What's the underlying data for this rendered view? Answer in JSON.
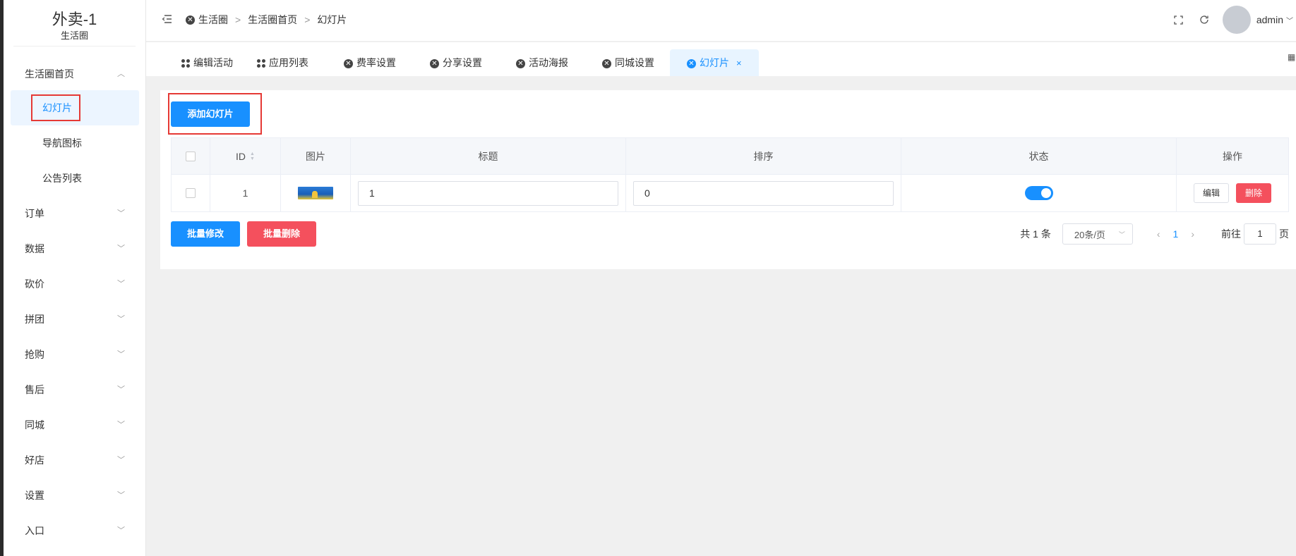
{
  "brand": {
    "title": "外卖-1",
    "subtitle": "生活圈"
  },
  "sidebar": {
    "items": [
      {
        "label": "生活圈首页",
        "chevron": "chevron-up-icon"
      },
      {
        "label": "幻灯片",
        "active": true
      },
      {
        "label": "导航图标"
      },
      {
        "label": "公告列表"
      },
      {
        "label": "订单",
        "chevron": "chevron-down-icon"
      },
      {
        "label": "数据",
        "chevron": "chevron-down-icon"
      },
      {
        "label": "砍价",
        "chevron": "chevron-down-icon"
      },
      {
        "label": "拼团",
        "chevron": "chevron-down-icon"
      },
      {
        "label": "抢购",
        "chevron": "chevron-down-icon"
      },
      {
        "label": "售后",
        "chevron": "chevron-down-icon"
      },
      {
        "label": "同城",
        "chevron": "chevron-down-icon"
      },
      {
        "label": "好店",
        "chevron": "chevron-down-icon"
      },
      {
        "label": "设置",
        "chevron": "chevron-down-icon"
      },
      {
        "label": "入口",
        "chevron": "chevron-down-icon"
      }
    ]
  },
  "breadcrumb": {
    "items": [
      "生活圈",
      "生活圈首页",
      "幻灯片"
    ],
    "separator": ">"
  },
  "user": {
    "name": "admin"
  },
  "tabs": [
    {
      "label": "编辑活动",
      "icon": "apps-icon"
    },
    {
      "label": "应用列表",
      "icon": "apps-icon"
    },
    {
      "label": "费率设置",
      "icon": "close-circle-icon"
    },
    {
      "label": "分享设置",
      "icon": "close-circle-icon"
    },
    {
      "label": "活动海报",
      "icon": "close-circle-icon"
    },
    {
      "label": "同城设置",
      "icon": "close-circle-icon"
    },
    {
      "label": "幻灯片",
      "icon": "close-circle-icon",
      "active": true,
      "close": "×"
    }
  ],
  "toolbar": {
    "add_label": "添加幻灯片"
  },
  "table": {
    "headers": {
      "id": "ID",
      "image": "图片",
      "title": "标题",
      "sort": "排序",
      "status": "状态",
      "actions": "操作"
    },
    "rows": [
      {
        "id": "1",
        "title": "1",
        "sort": "0",
        "status_on": true,
        "edit_label": "编辑",
        "delete_label": "删除"
      }
    ]
  },
  "bulk": {
    "edit_label": "批量修改",
    "delete_label": "批量删除"
  },
  "pagination": {
    "total": "共 1 条",
    "page_size": "20条/页",
    "current_page": "1",
    "goto_label": "前往",
    "goto_value": "1",
    "page_suffix": "页"
  },
  "colors": {
    "primary": "#1890ff",
    "danger": "#f4505d",
    "highlight_box": "#e53935"
  }
}
